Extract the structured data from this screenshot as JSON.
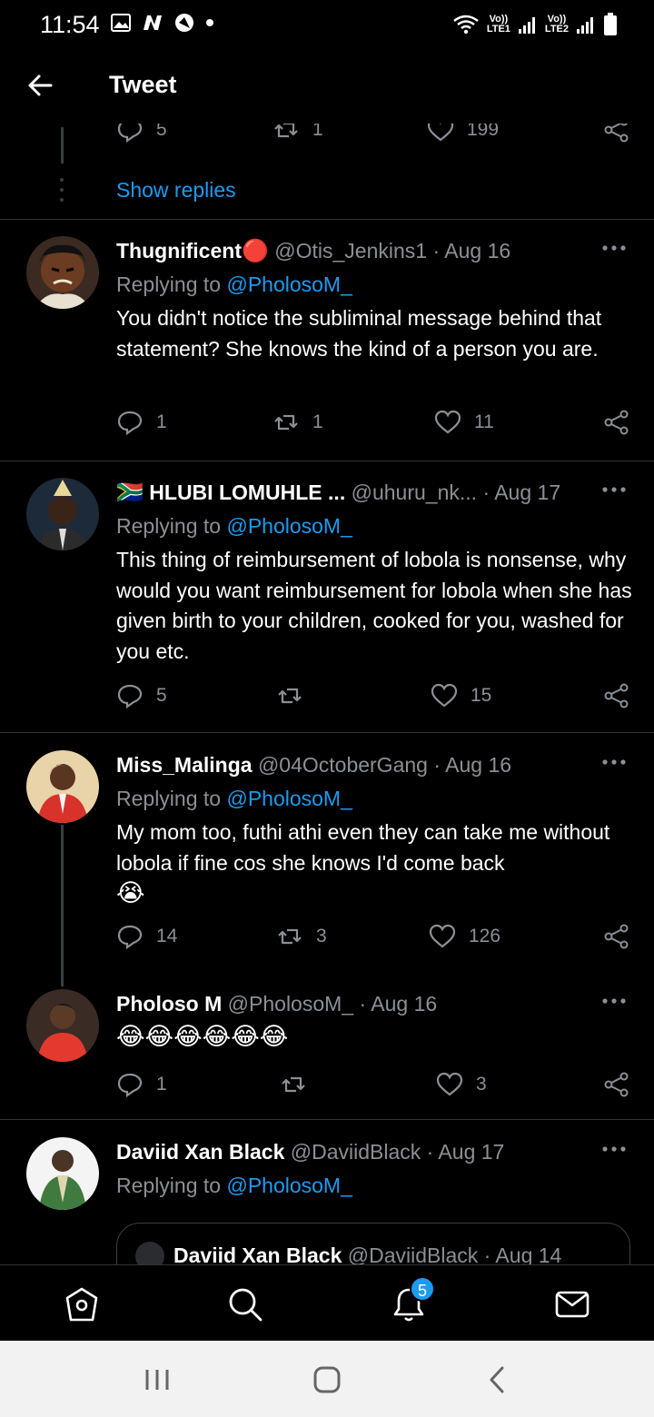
{
  "status_bar": {
    "time": "11:54",
    "icons": [
      "gallery-icon",
      "n-icon",
      "blocked-icon",
      "dot-icon"
    ],
    "lte1": "Vo)) LTE1",
    "lte2": "Vo)) LTE2"
  },
  "header": {
    "title": "Tweet"
  },
  "prev_tweet": {
    "replies": "5",
    "retweets": "1",
    "likes": "199"
  },
  "show_replies": "Show replies",
  "tweets": [
    {
      "name": "Thugnificent",
      "name_badge": "🔴",
      "handle": "@Otis_Jenkins1",
      "date": "· Aug 16",
      "replying_prefix": "Replying to",
      "replying_to": "@PholosoM_",
      "text": "You didn't notice the subliminal message behind that statement? She knows the kind of a person you are.",
      "replies": "1",
      "retweets": "1",
      "likes": "11"
    },
    {
      "flag": "🇿🇦",
      "name": "HLUBI LOMUHLE ...",
      "handle": "@uhuru_nk...",
      "date": "· Aug 17",
      "replying_prefix": "Replying to",
      "replying_to": "@PholosoM_",
      "text": "This thing of reimbursement of lobola is nonsense, why would you want reimbursement for lobola when she has given birth to your children, cooked for you, washed for you etc.",
      "replies": "5",
      "retweets": "",
      "likes": "15"
    },
    {
      "name": "Miss_Malinga",
      "handle": "@04OctoberGang",
      "date": "· Aug 16",
      "replying_prefix": "Replying to",
      "replying_to": "@PholosoM_",
      "text": "My mom too, futhi athi even they can take me without lobola if fine cos she knows I'd come back",
      "emoji": "😭",
      "replies": "14",
      "retweets": "3",
      "likes": "126"
    },
    {
      "name": "Pholoso M",
      "handle": "@PholosoM_",
      "date": "· Aug 16",
      "emoji": "😂😂😂😂😂😂",
      "replies": "1",
      "retweets": "",
      "likes": "3"
    },
    {
      "name": "Daviid Xan Black",
      "handle": "@DaviidBlack",
      "date": "· Aug 17",
      "replying_prefix": "Replying to",
      "replying_to": "@PholosoM_",
      "quote": {
        "name": "Daviid Xan Black",
        "handle": "@DaviidBlack",
        "date": "· Aug 14"
      }
    }
  ],
  "bottom_nav": {
    "items": [
      "home-icon",
      "search-icon",
      "notifications-icon",
      "messages-icon"
    ],
    "notification_count": "5"
  },
  "system_nav": [
    "recents-button",
    "home-button",
    "back-button"
  ],
  "colors": {
    "accent": "#1d9bf0",
    "muted": "#8b9096",
    "background": "#000000"
  }
}
